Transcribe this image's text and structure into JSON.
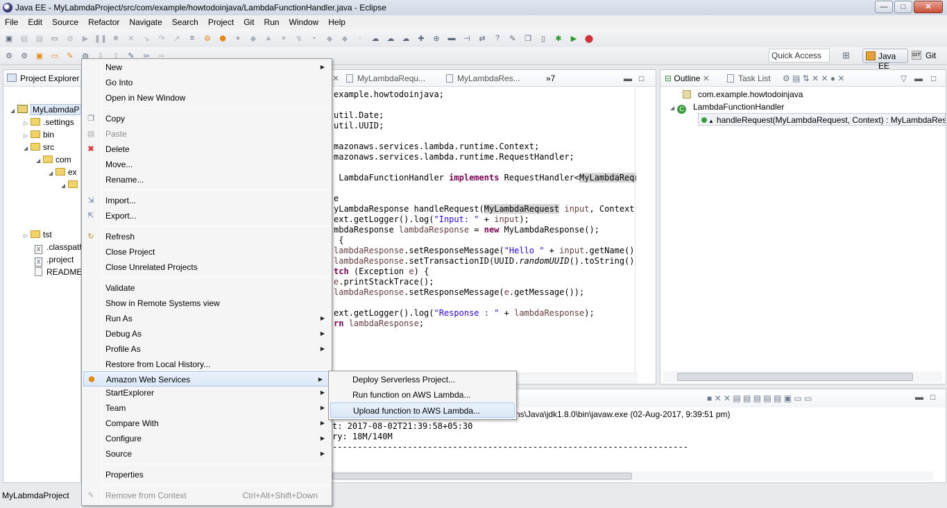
{
  "window": {
    "title": "Java EE - MyLabmdaProject/src/com/example/howtodoinjava/LambdaFunctionHandler.java - Eclipse",
    "min_glyph": "—",
    "max_glyph": "□",
    "close_glyph": "✕"
  },
  "menubar": [
    "File",
    "Edit",
    "Source",
    "Refactor",
    "Navigate",
    "Search",
    "Project",
    "Git",
    "Run",
    "Window",
    "Help"
  ],
  "toolbar": {
    "quick_access_placeholder": "Quick Access",
    "perspectives": [
      "Java EE",
      "Git"
    ]
  },
  "project_explorer": {
    "title": "Project Explorer",
    "items": [
      {
        "label": "MyLabmdaP",
        "kind": "project",
        "expanded": true
      },
      {
        "label": ".settings",
        "kind": "folder"
      },
      {
        "label": "bin",
        "kind": "folder"
      },
      {
        "label": "src",
        "kind": "folder",
        "expanded": true
      },
      {
        "label": "com",
        "kind": "folder",
        "expanded": true
      },
      {
        "label": "ex",
        "kind": "folder",
        "expanded": true
      },
      {
        "label": "",
        "kind": "folder",
        "expanded": true
      },
      {
        "label": "tst",
        "kind": "folder"
      },
      {
        "label": ".classpath",
        "kind": "xml"
      },
      {
        "label": ".project",
        "kind": "xml"
      },
      {
        "label": "README.",
        "kind": "doc"
      }
    ]
  },
  "editor": {
    "tabs": [
      "MyLambdaRequ...",
      "MyLambdaRes...",
      "»7"
    ],
    "lines": [
      "example.howtodoinjava;",
      "",
      "util.Date;",
      "util.UUID;",
      "",
      "mazonaws.services.lambda.runtime.Context;",
      "mazonaws.services.lambda.runtime.RequestHandler;",
      "",
      " LambdaFunctionHandler implements RequestHandler<MyLambdaReque",
      "",
      "e",
      "yLambdaResponse handleRequest(MyLambdaRequest input, Context c",
      "ext.getLogger().log(\"Input: \" + input);",
      "mbdaResponse lambdaResponse = new MyLambdaResponse();",
      " {",
      "lambdaResponse.setResponseMessage(\"Hello \" + input.getName() +",
      "lambdaResponse.setTransactionID(UUID.randomUUID().toString());",
      "tch (Exception e) {",
      "e.printStackTrace();",
      "lambdaResponse.setResponseMessage(e.getMessage());",
      "",
      "ext.getLogger().log(\"Response : \" + lambdaResponse);",
      "rn lambdaResponse;"
    ]
  },
  "outline": {
    "tabs": [
      "Outline",
      "Task List"
    ],
    "items": [
      {
        "label": "com.example.howtodoinjava"
      },
      {
        "label": "LambdaFunctionHandler"
      },
      {
        "label": "handleRequest(MyLambdaRequest, Context) : MyLambdaResp"
      }
    ]
  },
  "console": {
    "description": "ns\\Java\\jdk1.8.0\\bin\\javaw.exe (02-Aug-2017, 9:39:51 pm)",
    "lines": [
      "t: 2017-08-02T21:39:58+05:30",
      "ry: 18M/140M",
      "-----------------------------------------------------------------------"
    ]
  },
  "status": {
    "text": "MyLabmdaProject"
  },
  "context_menu": {
    "items": [
      {
        "label": "New",
        "submenu": true
      },
      {
        "label": "Go Into"
      },
      {
        "label": "Open in New Window"
      },
      {
        "label": "Copy",
        "icon": "copy-icon"
      },
      {
        "label": "Paste",
        "disabled": true,
        "icon": "paste-icon"
      },
      {
        "label": "Delete",
        "icon": "delete-icon"
      },
      {
        "label": "Move..."
      },
      {
        "label": "Rename..."
      },
      {
        "label": "Import...",
        "icon": "import-icon"
      },
      {
        "label": "Export...",
        "icon": "export-icon"
      },
      {
        "label": "Refresh",
        "icon": "refresh-icon"
      },
      {
        "label": "Close Project"
      },
      {
        "label": "Close Unrelated Projects"
      },
      {
        "label": "Validate"
      },
      {
        "label": "Show in Remote Systems view"
      },
      {
        "label": "Run As",
        "submenu": true
      },
      {
        "label": "Debug As",
        "submenu": true
      },
      {
        "label": "Profile As",
        "submenu": true
      },
      {
        "label": "Restore from Local History..."
      },
      {
        "label": "Amazon Web Services",
        "submenu": true,
        "hover": true,
        "icon": "aws-icon"
      },
      {
        "label": "StartExplorer",
        "submenu": true
      },
      {
        "label": "Team",
        "submenu": true
      },
      {
        "label": "Compare With",
        "submenu": true
      },
      {
        "label": "Configure",
        "submenu": true
      },
      {
        "label": "Source",
        "submenu": true
      },
      {
        "label": "Properties"
      },
      {
        "label": "Remove from Context",
        "disabled": true,
        "shortcut": "Ctrl+Alt+Shift+Down",
        "icon": "remove-context-icon"
      }
    ]
  },
  "aws_submenu": {
    "items": [
      {
        "label": "Deploy Serverless Project..."
      },
      {
        "label": "Run function on AWS Lambda..."
      },
      {
        "label": "Upload function to AWS Lambda...",
        "hover": true
      }
    ]
  }
}
